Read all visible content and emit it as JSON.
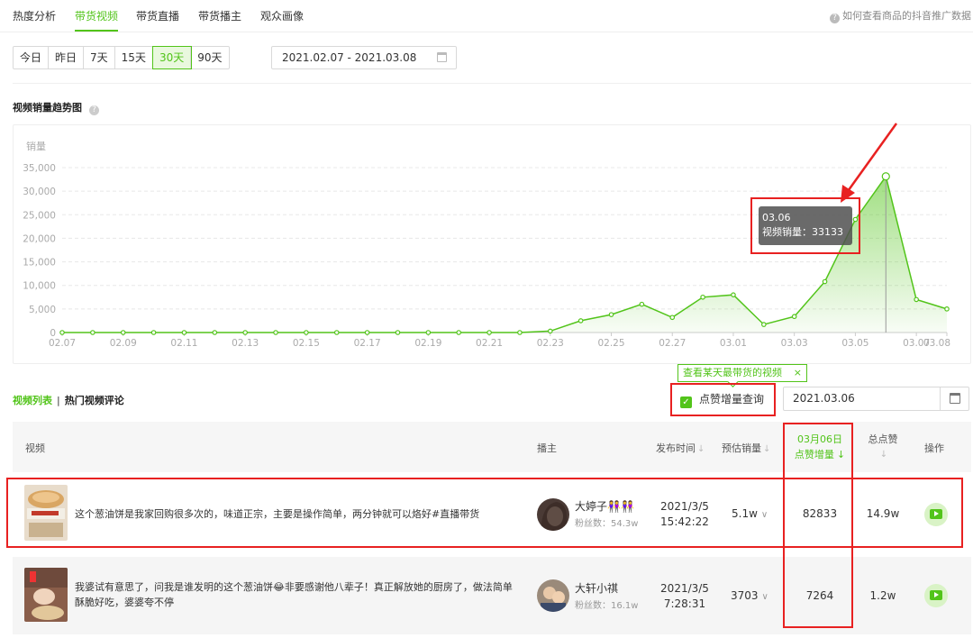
{
  "tabs": [
    {
      "label": "热度分析"
    },
    {
      "label": "带货视频"
    },
    {
      "label": "带货直播"
    },
    {
      "label": "带货播主"
    },
    {
      "label": "观众画像"
    }
  ],
  "help_link": "如何查看商品的抖音推广数据",
  "ranges": [
    "今日",
    "昨日",
    "7天",
    "15天",
    "30天",
    "90天"
  ],
  "active_range": "30天",
  "date_range": "2021.02.07 - 2021.03.08",
  "section_title": "视频销量趋势图",
  "chart_data": {
    "type": "area",
    "ylabel": "销量",
    "ylim": [
      0,
      35000
    ],
    "yticks": [
      "35,000",
      "30,000",
      "25,000",
      "20,000",
      "15,000",
      "10,000",
      "5,000",
      "0"
    ],
    "xticks": [
      "02.07",
      "02.09",
      "02.11",
      "02.13",
      "02.15",
      "02.17",
      "02.19",
      "02.21",
      "02.23",
      "02.25",
      "02.27",
      "03.01",
      "03.03",
      "03.05",
      "03.07",
      "03.08"
    ],
    "series": [
      {
        "values": [
          0,
          0,
          0,
          0,
          0,
          0,
          0,
          0,
          0,
          0,
          0,
          0,
          0,
          0,
          0,
          0,
          300,
          2500,
          3800,
          6000,
          3200,
          7500,
          8000,
          1700,
          3400,
          10800,
          24000,
          33133,
          7000,
          5000
        ]
      }
    ],
    "tooltip": {
      "date": "03.06",
      "label": "视频销量：",
      "value": "33133"
    },
    "color": "#52c41a"
  },
  "list_tab_active": "视频列表",
  "list_tab_sep": "|",
  "list_tab_other": "热门视频评论",
  "hint": "查看某天最带货的视频",
  "hint_close": "×",
  "checkbox_label": "点赞增量查询",
  "date_single": "2021.03.06",
  "table": {
    "headers": {
      "video": "视频",
      "host": "播主",
      "publish": "发布时间",
      "sales": "预估销量",
      "likes_date": "03月06日",
      "likes_inc": "点赞增量",
      "total_likes": "总点赞",
      "action": "操作"
    },
    "rows": [
      {
        "title": "这个葱油饼是我家回购很多次的，味道正宗，主要是操作简单，两分钟就可以烙好#直播带货",
        "host": "大婷子👭👭",
        "fans": "粉丝数：54.3w",
        "date": "2021/3/5",
        "time": "15:42:22",
        "sales": "5.1w",
        "likes_inc": "82833",
        "total_likes": "14.9w"
      },
      {
        "title": "我婆试有意思了，问我是谁发明的这个葱油饼😂非要感谢他八辈子！真正解放她的厨房了，做法简单酥脆好吃，婆婆夸不停",
        "host": "大轩小祺",
        "fans": "粉丝数：16.1w",
        "date": "2021/3/5",
        "time": "7:28:31",
        "sales": "3703",
        "likes_inc": "7264",
        "total_likes": "1.2w"
      }
    ]
  }
}
